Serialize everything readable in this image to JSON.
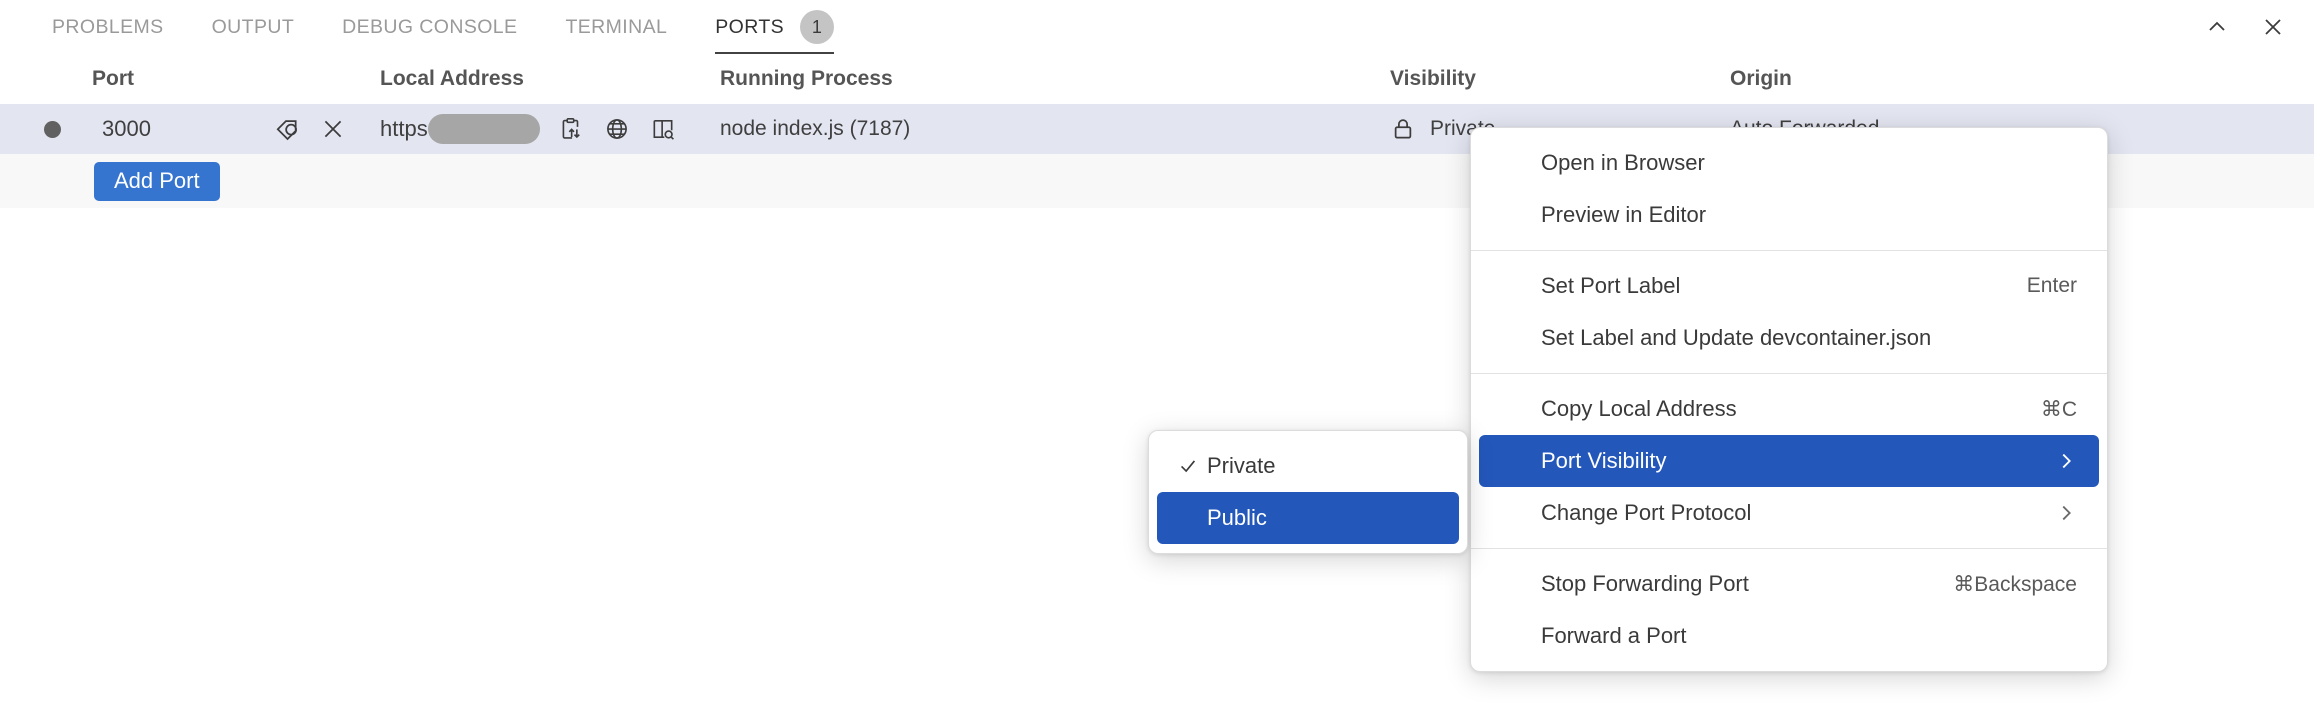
{
  "panel": {
    "tabs": [
      {
        "label": "PROBLEMS",
        "active": false,
        "badge": null
      },
      {
        "label": "OUTPUT",
        "active": false,
        "badge": null
      },
      {
        "label": "DEBUG CONSOLE",
        "active": false,
        "badge": null
      },
      {
        "label": "TERMINAL",
        "active": false,
        "badge": null
      },
      {
        "label": "PORTS",
        "active": true,
        "badge": "1"
      }
    ],
    "actions": [
      {
        "icon": "chevron-up-icon",
        "name": "collapse-panel-button"
      },
      {
        "icon": "close-icon",
        "name": "close-panel-button"
      }
    ]
  },
  "table": {
    "columns": [
      "Port",
      "Local Address",
      "Running Process",
      "Visibility",
      "Origin"
    ],
    "rows": [
      {
        "status_icon": "circle-filled-icon",
        "port": "3000",
        "row_actions": [
          {
            "icon": "tag-icon",
            "name": "set-port-label-button"
          },
          {
            "icon": "close-icon",
            "name": "stop-forwarding-port-button"
          }
        ],
        "local_address": "https:",
        "local_address_redacted": true,
        "address_actions": [
          {
            "icon": "copy-clipboard-icon",
            "name": "copy-local-address-button"
          },
          {
            "icon": "globe-icon",
            "name": "open-in-browser-button"
          },
          {
            "icon": "preview-in-editor-icon",
            "name": "preview-in-editor-button"
          }
        ],
        "running_process": "node index.js (7187)",
        "visibility_icon": "lock-icon",
        "visibility": "Private",
        "origin": "Auto Forwarded"
      }
    ],
    "add_port_label": "Add Port"
  },
  "context_menu": {
    "groups": [
      {
        "items": [
          {
            "label": "Open in Browser",
            "accel": "",
            "submenu": false,
            "selected": false,
            "checked": false
          },
          {
            "label": "Preview in Editor",
            "accel": "",
            "submenu": false,
            "selected": false,
            "checked": false
          }
        ]
      },
      {
        "items": [
          {
            "label": "Set Port Label",
            "accel": "Enter",
            "submenu": false,
            "selected": false,
            "checked": false
          },
          {
            "label": "Set Label and Update devcontainer.json",
            "accel": "",
            "submenu": false,
            "selected": false,
            "checked": false
          }
        ]
      },
      {
        "items": [
          {
            "label": "Copy Local Address",
            "accel": "⌘C",
            "submenu": false,
            "selected": false,
            "checked": false
          },
          {
            "label": "Port Visibility",
            "accel": "",
            "submenu": true,
            "selected": true,
            "checked": false
          },
          {
            "label": "Change Port Protocol",
            "accel": "",
            "submenu": true,
            "selected": false,
            "checked": false
          }
        ]
      },
      {
        "items": [
          {
            "label": "Stop Forwarding Port",
            "accel": "⌘Backspace",
            "submenu": false,
            "selected": false,
            "checked": false
          },
          {
            "label": "Forward a Port",
            "accel": "",
            "submenu": false,
            "selected": false,
            "checked": false
          }
        ]
      }
    ]
  },
  "submenu": {
    "items": [
      {
        "label": "Private",
        "checked": true,
        "selected": false
      },
      {
        "label": "Public",
        "checked": false,
        "selected": true
      }
    ]
  },
  "colors": {
    "accent": "#2357ba",
    "button": "#3574cf",
    "row_highlight": "#e3e5f1",
    "redaction": "#a6a6a6"
  }
}
